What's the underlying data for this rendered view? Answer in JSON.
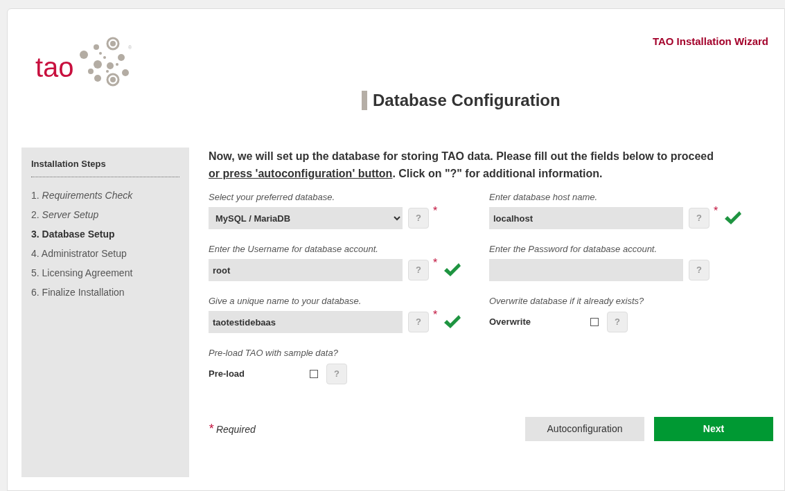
{
  "logo": {
    "text": "tao",
    "mark": "®"
  },
  "wizard_title": "TAO Installation Wizard",
  "page_title": "Database Configuration",
  "sidebar": {
    "title": "Installation Steps",
    "items": [
      {
        "number": "1.",
        "label": "Requirements Check",
        "completed": true,
        "selected": false
      },
      {
        "number": "2.",
        "label": "Server Setup",
        "completed": true,
        "selected": false
      },
      {
        "number": "3.",
        "label": "Database Setup",
        "completed": false,
        "selected": true
      },
      {
        "number": "4.",
        "label": "Administrator Setup",
        "completed": false,
        "selected": false
      },
      {
        "number": "5.",
        "label": "Licensing Agreement",
        "completed": false,
        "selected": false
      },
      {
        "number": "6.",
        "label": "Finalize Installation",
        "completed": false,
        "selected": false
      }
    ]
  },
  "intro": {
    "before": "Now, we will set up the database for storing TAO data. Please fill out the fields below to proceed ",
    "link": "or press 'autoconfiguration' button",
    "after": ". Click on \"?\" for additional information."
  },
  "fields": [
    {
      "kind": "select",
      "label": "Select your preferred database.",
      "value": "MySQL / MariaDB",
      "help": "?",
      "required": true,
      "valid": false
    },
    {
      "kind": "text",
      "label": "Enter database host name.",
      "value": "localhost",
      "help": "?",
      "required": true,
      "valid": true
    },
    {
      "kind": "text",
      "label": "Enter the Username for database account.",
      "value": "root",
      "help": "?",
      "required": true,
      "valid": true
    },
    {
      "kind": "password",
      "label": "Enter the Password for database account.",
      "help": "?",
      "required": false,
      "valid": false
    },
    {
      "kind": "text",
      "label": "Give a unique name to your database.",
      "value": "taotestidebaas",
      "help": "?",
      "required": true,
      "valid": true
    },
    {
      "kind": "checkbox",
      "label": "Overwrite database if it already exists?",
      "option": "Overwrite",
      "checked": false,
      "help": "?",
      "required": false,
      "valid": false
    },
    {
      "kind": "checkbox",
      "label": "Pre-load TAO with sample data?",
      "option": "Pre-load",
      "checked": false,
      "help": "?",
      "required": false,
      "valid": false
    }
  ],
  "required_note": {
    "mark": "*",
    "text": "Required"
  },
  "buttons": [
    {
      "label": "Autoconfiguration",
      "kind": "secondary"
    },
    {
      "label": "Next",
      "kind": "primary"
    }
  ]
}
